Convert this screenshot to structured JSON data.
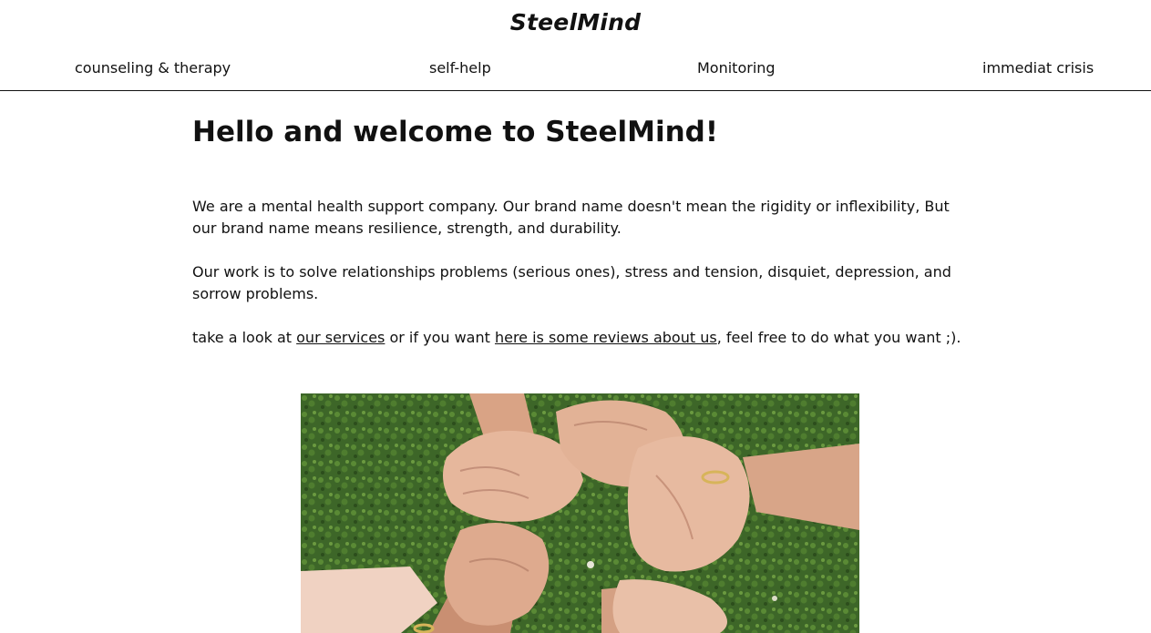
{
  "brand": {
    "name": "SteelMind"
  },
  "nav": {
    "items": [
      {
        "label": "counseling & therapy"
      },
      {
        "label": "self-help"
      },
      {
        "label": "Monitoring"
      },
      {
        "label": "immediat crisis"
      }
    ]
  },
  "main": {
    "heading": "Hello and welcome to SteelMind!",
    "para1": "We are a mental health support company. Our brand name doesn't mean the rigidity or inflexibility, But our brand name means resilience, strength, and durability.",
    "para2": "Our work is to solve relationships problems (serious ones), stress and tension, disquiet, depression, and sorrow problems.",
    "para3": {
      "text_before": "take a look at ",
      "link_services": "our services",
      "text_middle": " or if you want ",
      "link_reviews": "here is some reviews about us",
      "text_after": ", feel free to do what you want ;)."
    }
  },
  "colors": {
    "text": "#111111",
    "background": "#ffffff",
    "grass": "#3f6a2a",
    "skin": "#e3b49a"
  }
}
